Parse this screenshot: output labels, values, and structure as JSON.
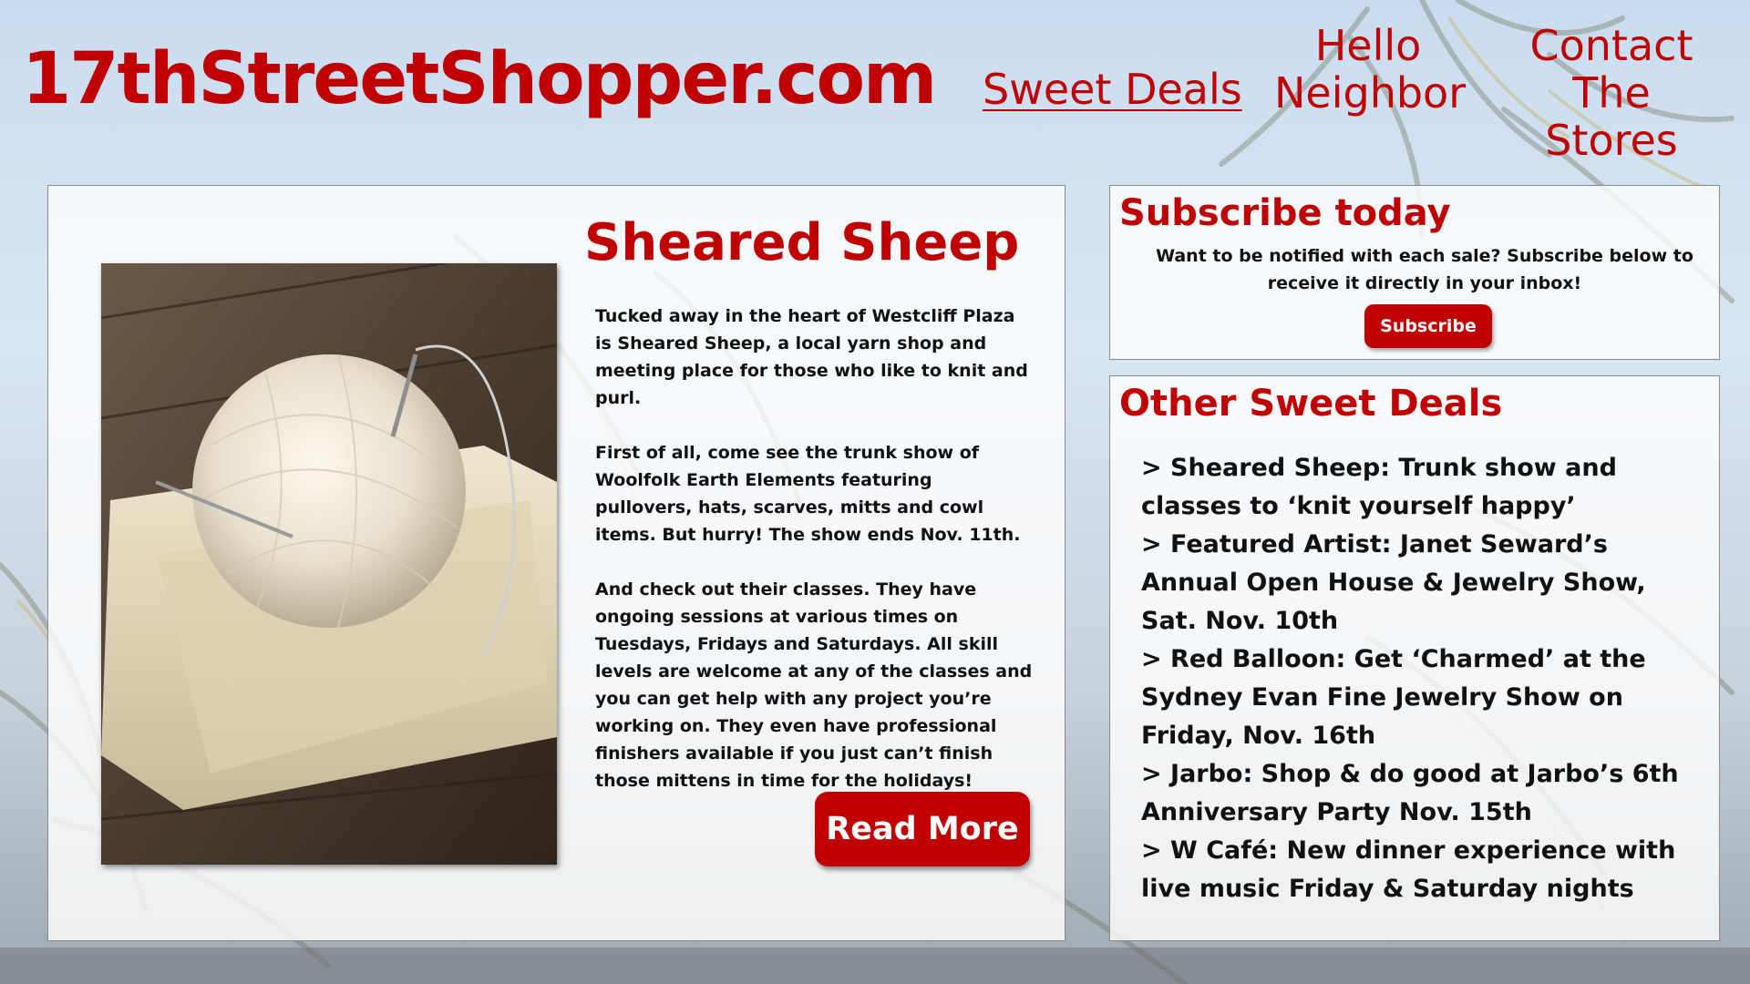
{
  "site": {
    "logo": "17thStreetShopper.com"
  },
  "nav": {
    "sweet_deals": "Sweet Deals",
    "hello_neighbor_line1": "Hello",
    "hello_neighbor_line2": "Neighbor",
    "contact_line1": "Contact",
    "contact_line2": "The Stores"
  },
  "article": {
    "title": "Sheared Sheep",
    "paragraphs": [
      "Tucked away in the heart of Westcliff Plaza is Sheared Sheep, a local yarn shop and meeting place for those who like to knit and purl.",
      "First of all, come see the trunk show of Woolfolk Earth Elements featuring pullovers, hats, scarves, mitts and cowl items. But hurry! The show ends Nov. 11th.",
      "And check out their classes. They have ongoing sessions at various times on Tuesdays, Fridays and Saturdays. All skill levels are welcome at any of the classes and you can get help with any project you’re working on. They even have professional finishers available if you just can’t finish those mittens in time for the holidays!"
    ],
    "read_more": "Read More"
  },
  "subscribe": {
    "title": "Subscribe today",
    "text": "Want to be notified with each sale? Subscribe below to receive it directly in your inbox!",
    "button": "Subscribe"
  },
  "deals": {
    "title": "Other Sweet Deals",
    "items": [
      "> Sheared Sheep: Trunk show and classes to ‘knit yourself happy’",
      "> Featured Artist: Janet Seward’s Annual Open House & Jewelry Show, Sat. Nov. 10th",
      "> Red Balloon: Get ‘Charmed’ at the Sydney Evan Fine Jewelry Show on Friday, Nov. 16th",
      "> Jarbo: Shop & do good at Jarbo’s 6th Anniversary Party Nov. 15th",
      "> W Café: New dinner experience with live music Friday & Saturday nights"
    ]
  },
  "colors": {
    "accent": "#c00000",
    "panel_bg": "#ffffff",
    "text": "#111111"
  },
  "images": {
    "background": "palm-trees-sky",
    "article_photo": "yarn-ball-knitting-needles"
  }
}
